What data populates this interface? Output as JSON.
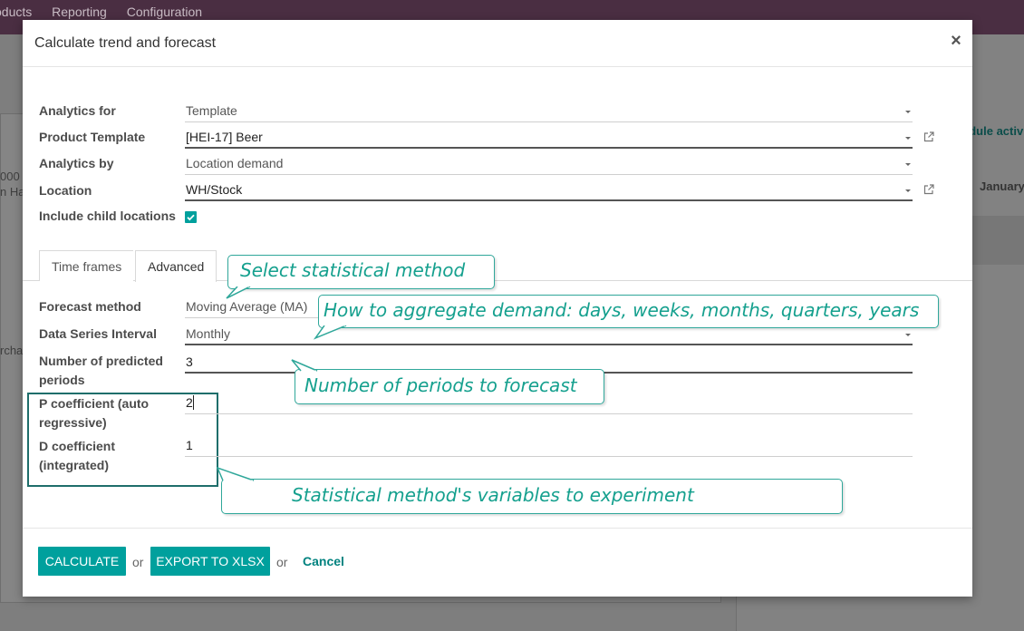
{
  "background": {
    "menu": [
      "oducts",
      "Reporting",
      "Configuration"
    ],
    "left_fragments": [
      "000",
      "n Ha",
      "rcha"
    ],
    "right_link": "edule activ",
    "right_month": "January"
  },
  "dialog": {
    "title": "Calculate trend and forecast",
    "close_icon": "×",
    "fields": {
      "analytics_for": {
        "label": "Analytics for",
        "value": "Template"
      },
      "product_template": {
        "label": "Product Template",
        "value": "[HEI-17] Beer"
      },
      "analytics_by": {
        "label": "Analytics by",
        "value": "Location demand"
      },
      "location": {
        "label": "Location",
        "value": "WH/Stock"
      },
      "include_child": {
        "label": "Include child locations",
        "checked": true
      }
    },
    "tabs": [
      "Time frames",
      "Advanced"
    ],
    "active_tab": "Advanced",
    "advanced": {
      "forecast_method": {
        "label": "Forecast method",
        "value": "Moving Average (MA)"
      },
      "interval": {
        "label": "Data Series Interval",
        "value": "Monthly"
      },
      "predicted_periods": {
        "label_line1": "Number of predicted",
        "label_line2": "periods",
        "value": "3"
      },
      "p_coef": {
        "label_line1": "P coefficient (auto",
        "label_line2": "regressive)",
        "value": "2"
      },
      "d_coef": {
        "label_line1": "D coefficient",
        "label_line2": "(integrated)",
        "value": "1"
      }
    },
    "footer": {
      "calculate": "CALCULATE",
      "or1": "or",
      "export": "EXPORT TO XLSX",
      "or2": "or",
      "cancel": "Cancel"
    },
    "accent_color": "#00a09d"
  },
  "callouts": {
    "method": "Select statistical method",
    "aggregate": "How to aggregate demand: days, weeks, months, quarters, years",
    "periods": "Number of periods to forecast",
    "variables": "Statistical method's variables to experiment"
  }
}
